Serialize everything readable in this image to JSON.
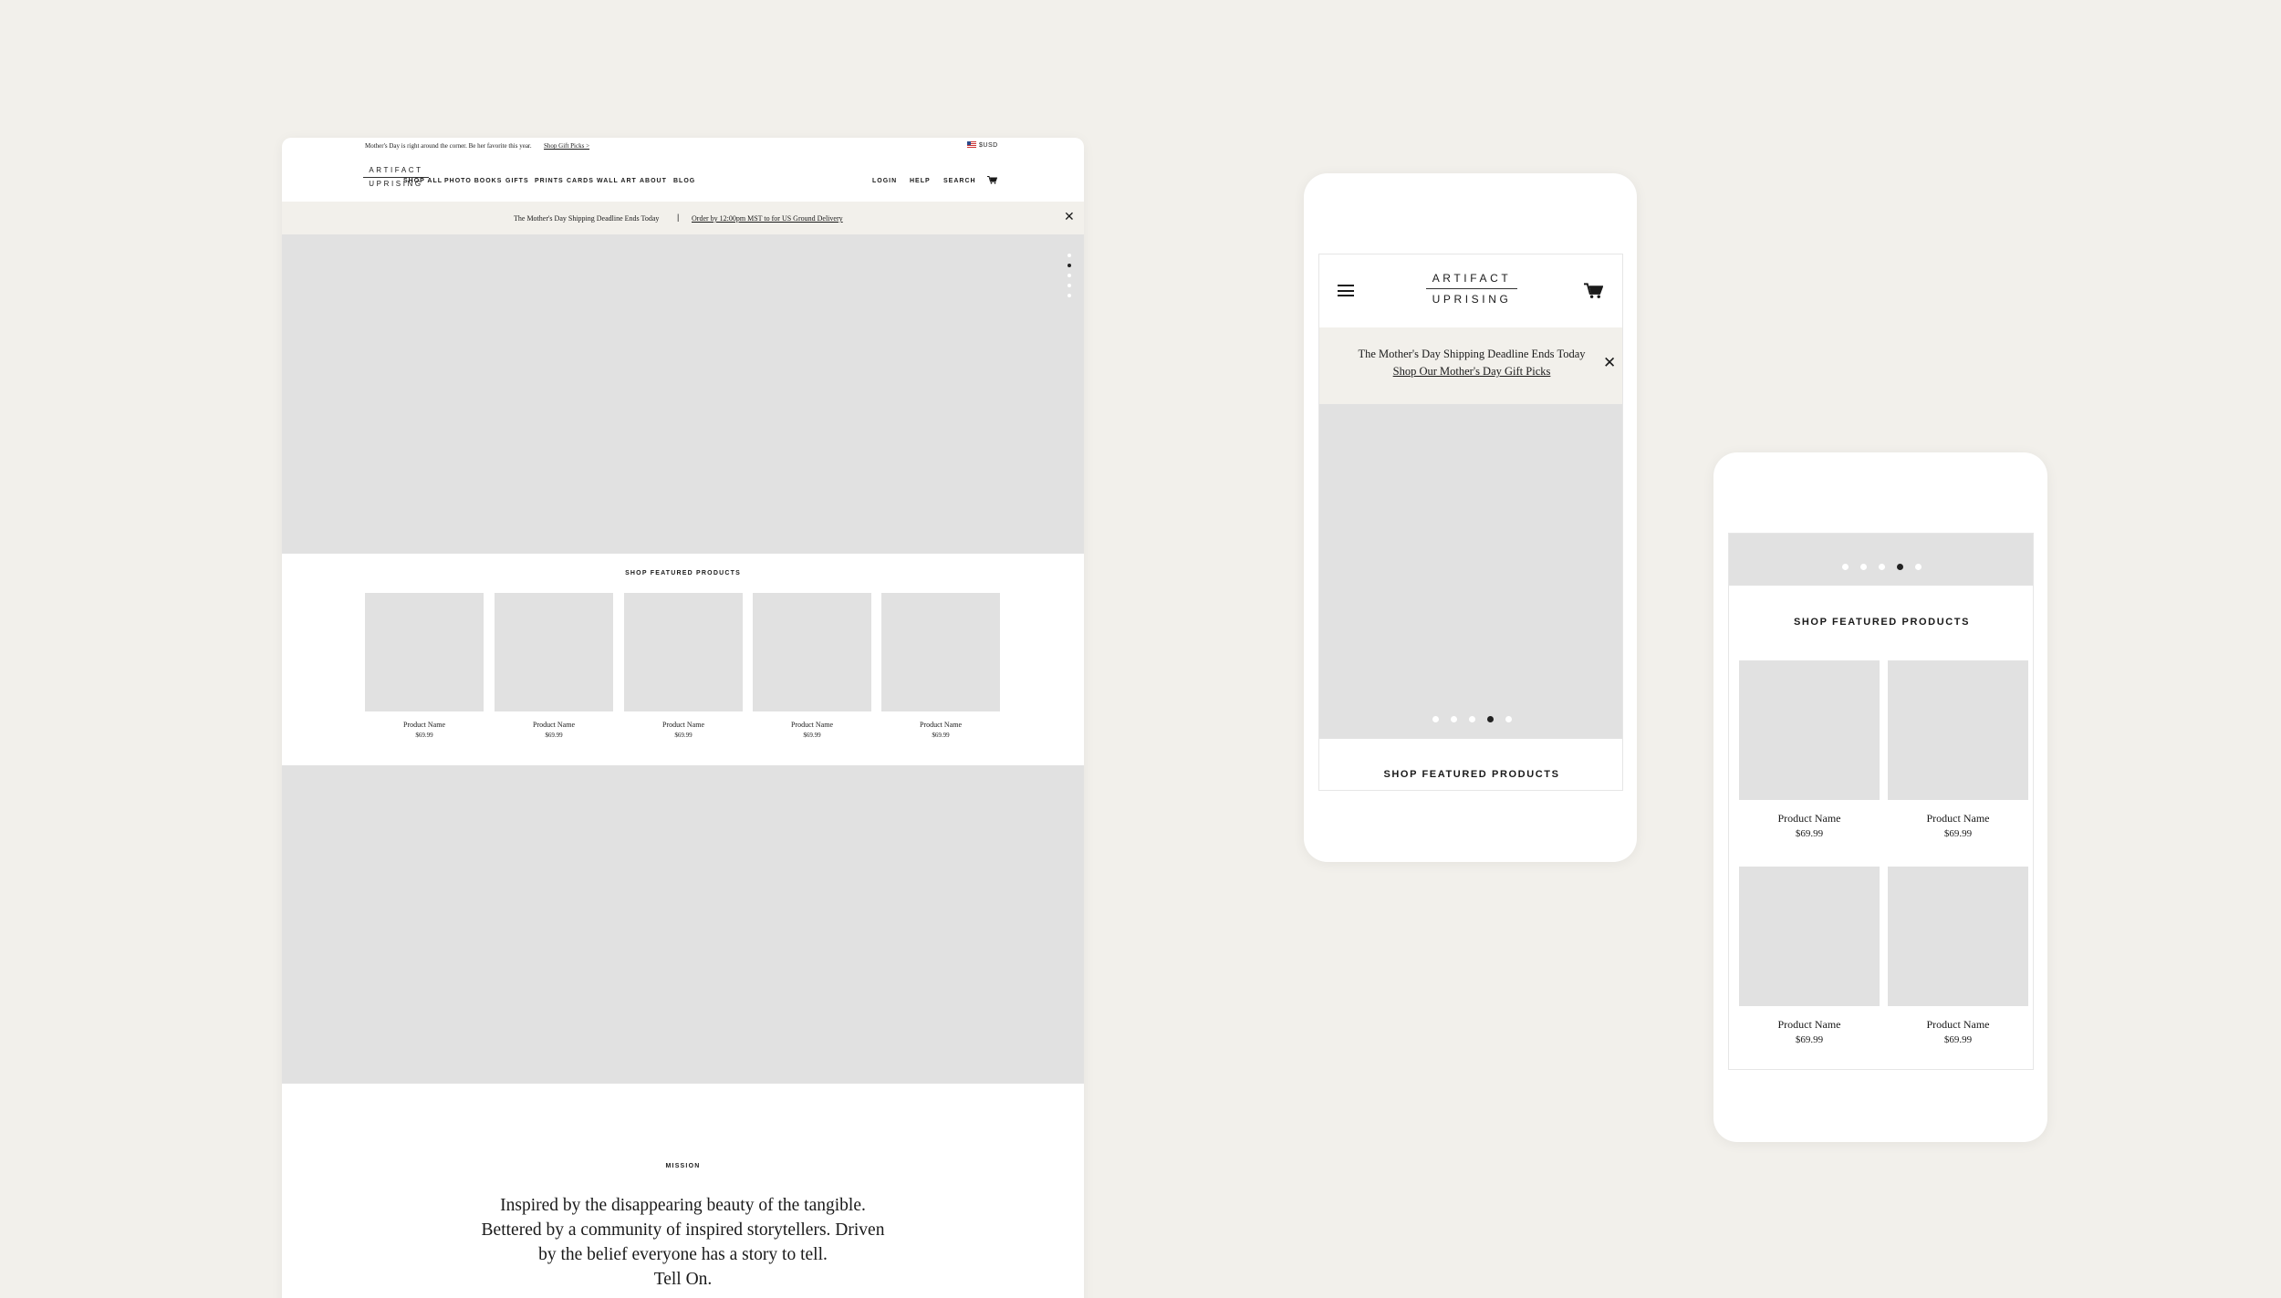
{
  "desktop": {
    "topbar": {
      "promo_text": "Mother's Day is right around the corner. Be her favorite this year.",
      "promo_link": "Shop Gift Picks >",
      "currency": "$USD"
    },
    "logo": {
      "line1": "ARTIFACT",
      "line2": "UPRISING"
    },
    "nav": [
      "SHOP ALL",
      "PHOTO BOOKS",
      "GIFTS",
      "PRINTS",
      "CARDS",
      "WALL ART",
      "ABOUT",
      "BLOG"
    ],
    "utility_nav": [
      "LOGIN",
      "HELP",
      "SEARCH"
    ],
    "shipping_banner": {
      "text": "The Mother's Day Shipping Deadline Ends Today",
      "separator": "|",
      "link": "Order by 12:00pm MST to for US Ground Delivery",
      "close": "✕"
    },
    "hero_slides": {
      "count": 5,
      "active_index": 1
    },
    "featured": {
      "title": "SHOP FEATURED PRODUCTS",
      "products": [
        {
          "name": "Product Name",
          "price": "$69.99"
        },
        {
          "name": "Product Name",
          "price": "$69.99"
        },
        {
          "name": "Product Name",
          "price": "$69.99"
        },
        {
          "name": "Product Name",
          "price": "$69.99"
        },
        {
          "name": "Product Name",
          "price": "$69.99"
        }
      ]
    },
    "mission": {
      "label": "MISSION",
      "lines": [
        "Inspired by the disappearing beauty of the tangible.",
        "Bettered by a community of inspired storytellers. Driven",
        "by the belief everyone has a story to tell.",
        "Tell On."
      ]
    }
  },
  "mobile1": {
    "logo": {
      "line1": "ARTIFACT",
      "line2": "UPRISING"
    },
    "shipping_banner": {
      "text": "The Mother's Day Shipping Deadline Ends Today",
      "link": "Shop Our Mother's Day Gift Picks",
      "close": "✕"
    },
    "hero_slides": {
      "count": 5,
      "active_index": 3
    },
    "featured_title": "SHOP FEATURED PRODUCTS"
  },
  "mobile2": {
    "hero_slides": {
      "count": 5,
      "active_index": 3
    },
    "featured": {
      "title": "SHOP FEATURED PRODUCTS",
      "products": [
        {
          "name": "Product Name",
          "price": "$69.99"
        },
        {
          "name": "Product Name",
          "price": "$69.99"
        },
        {
          "name": "Product Name",
          "price": "$69.99"
        },
        {
          "name": "Product Name",
          "price": "$69.99"
        }
      ]
    }
  },
  "icons": {
    "flag": "us-flag-icon",
    "cart": "cart-icon",
    "menu": "hamburger-icon",
    "close": "close-icon"
  }
}
